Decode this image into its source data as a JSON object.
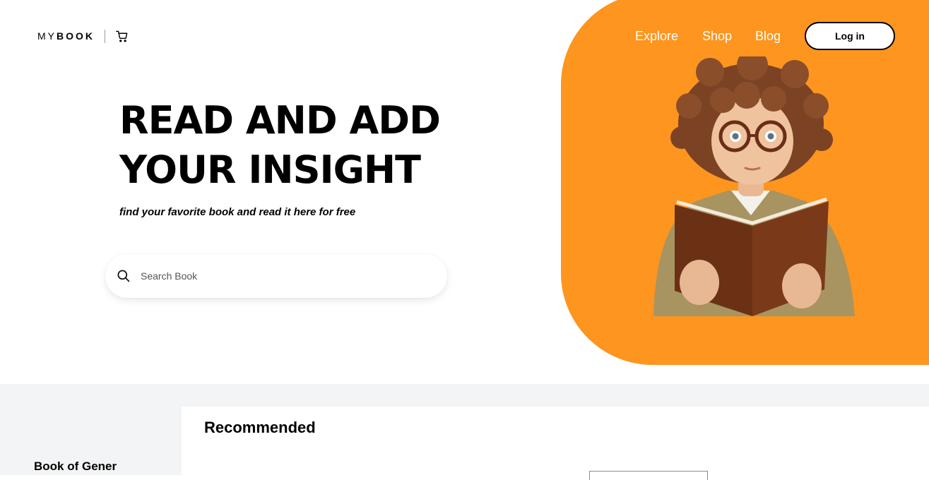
{
  "brand": {
    "logo_prefix": "MY",
    "logo_main": "BOOK",
    "cart_icon": "shopping-cart-icon"
  },
  "nav": {
    "explore": "Explore",
    "shop": "Shop",
    "blog": "Blog",
    "login": "Log in"
  },
  "hero": {
    "title_line1": "READ AND ADD",
    "title_line2": "YOUR INSIGHT",
    "subtitle": "find your favorite book and read it here for free",
    "accent_color": "#fe951f"
  },
  "search": {
    "placeholder": "Search Book",
    "icon": "search-icon"
  },
  "sidebar": {
    "heading": "Book of Gener"
  },
  "recommended": {
    "heading": "Recommended"
  }
}
